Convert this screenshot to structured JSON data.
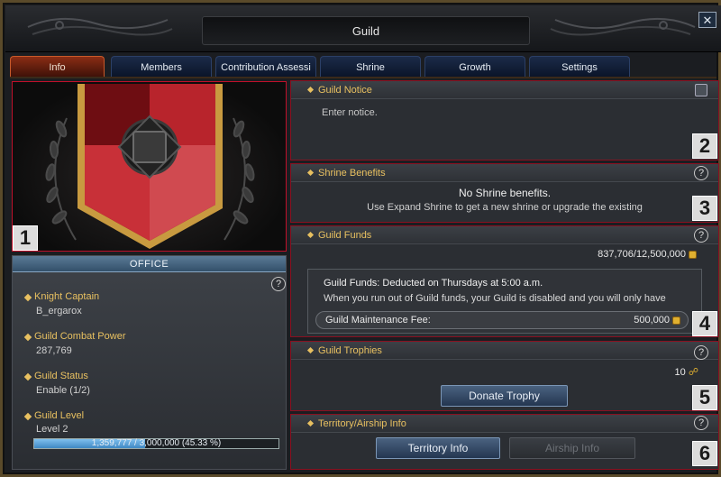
{
  "window": {
    "title": "Guild",
    "close_label": "✕"
  },
  "tabs": [
    {
      "label": "Info",
      "active": true
    },
    {
      "label": "Members",
      "active": false
    },
    {
      "label": "Contribution Assessi",
      "active": false
    },
    {
      "label": "Shrine",
      "active": false
    },
    {
      "label": "Growth",
      "active": false
    },
    {
      "label": "Settings",
      "active": false
    }
  ],
  "badges": [
    "1",
    "2",
    "3",
    "4",
    "5",
    "6"
  ],
  "office": {
    "header": "OFFICE",
    "help": "?",
    "stats": [
      {
        "label": "Knight Captain",
        "value": "B_ergarox"
      },
      {
        "label": "Guild Combat Power",
        "value": "287,769"
      },
      {
        "label": "Guild Status",
        "value": "Enable (1/2)"
      },
      {
        "label": "Guild Level",
        "value": "Level 2"
      }
    ],
    "progress_text": "1,359,777 / 3,000,000 (45.33 %)",
    "progress_fraction": 0.4533
  },
  "notice": {
    "title": "Guild Notice",
    "placeholder": "Enter notice.",
    "edit_icon": "edit-icon"
  },
  "shrine": {
    "title": "Shrine Benefits",
    "help": "?",
    "message": "No Shrine benefits.",
    "hint": "Use Expand Shrine to get a new shrine or upgrade the existing"
  },
  "funds": {
    "title": "Guild Funds",
    "help": "?",
    "amount": "837,706/12,500,000",
    "info_line1": "Guild Funds: Deducted on Thursdays at 5:00 a.m.",
    "info_line2": "When you run out of Guild funds, your Guild is disabled and you will only have",
    "fee_label": "Guild Maintenance Fee:",
    "fee_value": "500,000"
  },
  "trophies": {
    "title": "Guild Trophies",
    "help": "?",
    "count": "10",
    "donate_label": "Donate Trophy"
  },
  "territory": {
    "title": "Territory/Airship Info",
    "help": "?",
    "territory_btn": "Territory Info",
    "airship_btn": "Airship Info"
  },
  "colors": {
    "accent_gold": "#e8c060",
    "section_border": "#8a1020",
    "active_tab": "#8a2d14"
  }
}
